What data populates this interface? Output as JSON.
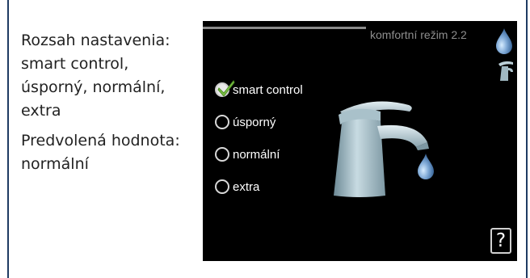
{
  "info": {
    "range_text": "Rozsah nastavenia: smart control, úsporný, normální, extra",
    "default_text": "Predvolená hodnota: normální"
  },
  "screen": {
    "title": "komfortní režim 2.2",
    "help_label": "?"
  },
  "options": [
    {
      "label": "smart control",
      "selected": true
    },
    {
      "label": "úsporný",
      "selected": false
    },
    {
      "label": "normální",
      "selected": false
    },
    {
      "label": "extra",
      "selected": false
    }
  ],
  "icons": {
    "top_drop": "water-drop-icon",
    "mini_faucet": "faucet-icon",
    "main_faucet": "faucet-illustration",
    "check": "checkmark-icon",
    "help": "help-icon"
  },
  "colors": {
    "screen_bg": "#000000",
    "drop": "#7fa9d6",
    "faucet": "#a8c0c9",
    "check": "#7ac143"
  }
}
